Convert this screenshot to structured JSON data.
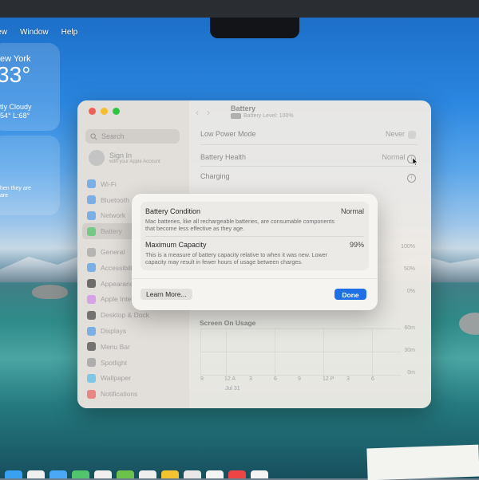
{
  "menubar": [
    "iew",
    "Window",
    "Help"
  ],
  "weather": {
    "city": "ew York",
    "temp": "33°",
    "condition": "tly Cloudy",
    "hilo": "54° L:68°"
  },
  "widget2_text": "hen they are\nare",
  "window": {
    "title": "Battery",
    "subtitle": "Battery Level: 100%",
    "search_placeholder": "Search",
    "account_title": "Sign In",
    "account_sub": "with your Apple Account",
    "sidebar": [
      {
        "label": "Wi-Fi",
        "color": "#3b8ff0"
      },
      {
        "label": "Bluetooth",
        "color": "#3b8ff0"
      },
      {
        "label": "Network",
        "color": "#3b8ff0"
      },
      {
        "label": "Battery",
        "color": "#34c759",
        "active": true
      },
      {
        "label": "General",
        "color": "#9a9a9a"
      },
      {
        "label": "Accessibility",
        "color": "#3b8ff0"
      },
      {
        "label": "Appearance",
        "color": "#222222"
      },
      {
        "label": "Apple Intelligence",
        "color": "#d07af0"
      },
      {
        "label": "Desktop & Dock",
        "color": "#2b2b2b"
      },
      {
        "label": "Displays",
        "color": "#3b8ff0"
      },
      {
        "label": "Menu Bar",
        "color": "#2b2b2b"
      },
      {
        "label": "Spotlight",
        "color": "#8e8e93"
      },
      {
        "label": "Wallpaper",
        "color": "#3fb8f0"
      },
      {
        "label": "Notifications",
        "color": "#ef4a4a"
      }
    ],
    "low_power_label": "Low Power Mode",
    "low_power_value": "Never",
    "battery_health_label": "Battery Health",
    "battery_health_value": "Normal",
    "charging_label": "Charging",
    "pcts": [
      "100%",
      "50%",
      "0%"
    ],
    "screen_on_title": "Screen On Usage",
    "screen_on_ticks": [
      "60m",
      "30m",
      "0m"
    ],
    "x_ticks": [
      "9",
      "12 A",
      "3",
      "6",
      "9",
      "12 P",
      "3",
      "6"
    ],
    "date_label": "Jul 31"
  },
  "dialog": {
    "condition_title": "Battery Condition",
    "condition_value": "Normal",
    "condition_desc": "Mac batteries, like all rechargeable batteries, are consumable components that become less effective as they age.",
    "capacity_title": "Maximum Capacity",
    "capacity_value": "99%",
    "capacity_desc": "This is a measure of battery capacity relative to when it was new. Lower capacity may result in fewer hours of usage between charges.",
    "learn_more": "Learn More...",
    "done": "Done"
  }
}
